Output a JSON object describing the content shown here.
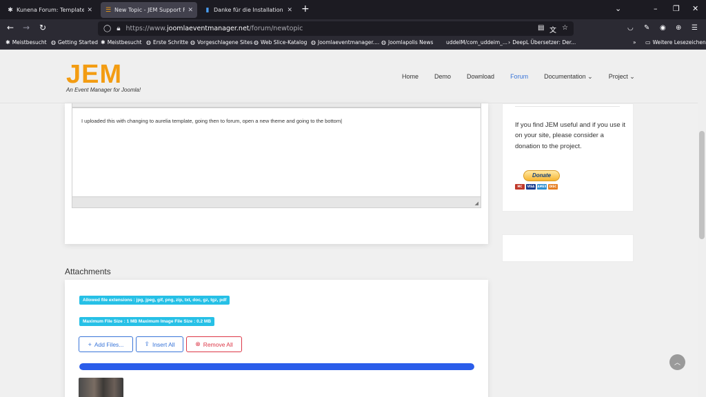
{
  "tabs": [
    {
      "label": "Kunena Forum: Templates - Joo",
      "icon": "joomla-icon",
      "active": false
    },
    {
      "label": "New Topic - JEM Support Foru",
      "icon": "menu-icon",
      "active": true
    },
    {
      "label": "Danke für die Installation von |",
      "icon": "chart-icon",
      "active": false
    }
  ],
  "url": {
    "prefix": "https://www.",
    "host": "joomlaeventmanager.net",
    "path": "/forum/newtopic"
  },
  "bookmarks": [
    {
      "label": "Meistbesucht",
      "icon": "gear-icon"
    },
    {
      "label": "Getting Started",
      "icon": "globe-icon"
    },
    {
      "label": "Meistbesucht",
      "icon": "gear-icon"
    },
    {
      "label": "Erste Schritte",
      "icon": "globe-icon"
    },
    {
      "label": "Vorgeschlagene Sites",
      "icon": "globe-icon"
    },
    {
      "label": "Web Slice-Katalog",
      "icon": "globe-icon"
    },
    {
      "label": "Joomlaeventmanager....",
      "icon": "globe-icon"
    },
    {
      "label": "Joomlapolis News",
      "icon": "globe-icon"
    },
    {
      "label": "uddeIM/com_uddeim_...",
      "icon": ""
    },
    {
      "label": "DeepL Übersetzer: Der...",
      "icon": "arrow-icon"
    }
  ],
  "bookmarks_more": "Weitere Lesezeichen",
  "site": {
    "logo_mark": "JEM",
    "logo_tagline": "An Event Manager for Joomla!",
    "nav": [
      {
        "label": "Home",
        "active": false,
        "dropdown": false
      },
      {
        "label": "Demo",
        "active": false,
        "dropdown": false
      },
      {
        "label": "Download",
        "active": false,
        "dropdown": false
      },
      {
        "label": "Forum",
        "active": true,
        "dropdown": false
      },
      {
        "label": "Documentation",
        "active": false,
        "dropdown": true
      },
      {
        "label": "Project",
        "active": false,
        "dropdown": true
      }
    ]
  },
  "editor": {
    "text": "I uploaded this with changing to aurelia template, going then to forum, open a new theme and going to the bottom"
  },
  "sidebar": {
    "donate_text": "If you find JEM useful and if you use it on your site, please consider a donation to the project.",
    "donate_button": "Donate",
    "cards": [
      "VISA",
      "MC",
      "AMEX",
      "DISC"
    ]
  },
  "attachments": {
    "title": "Attachments",
    "allowed_ext": "Allowed file extensions : jpg, jpeg, gif, png, zip, txt, doc, gz, tgz, pdf",
    "max_size": "Maximum File Size : 1 MB Maximum Image File Size : 0.2 MB",
    "buttons": {
      "add": "Add Files...",
      "insert": "Insert All",
      "remove": "Remove All"
    },
    "progress": 1.0
  },
  "colors": {
    "accent": "#3874d8",
    "logo": "#f39c12",
    "badge": "#26c0e6",
    "progress": "#2b5dea",
    "danger": "#dc3545"
  }
}
